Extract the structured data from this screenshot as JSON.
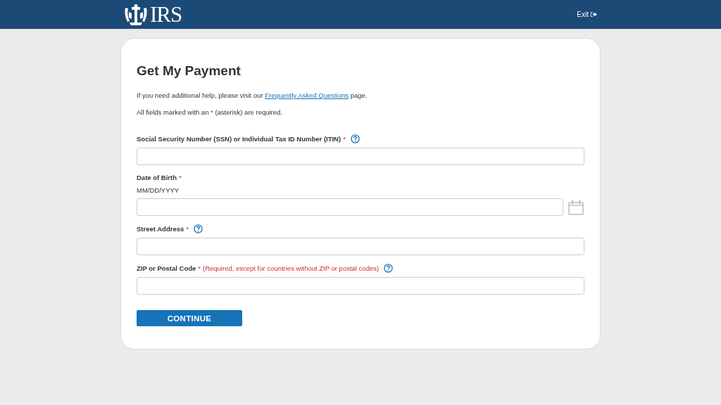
{
  "header": {
    "logo_text": "IRS",
    "exit_link": "Exit"
  },
  "form": {
    "title": "Get My Payment",
    "help_text": {
      "before": "If you need additional help, please visit our",
      "link": "Frequently Asked Questions",
      "after": "page."
    },
    "required_note": {
      "before": "All fields marked with an",
      "mark": "*",
      "after": "(asterisk) are required."
    },
    "fields": [
      {
        "kind": "text",
        "label": "Social Security Number (SSN) or Individual Tax ID Number (ITIN)",
        "required_mark": "*",
        "help": true
      },
      {
        "kind": "date",
        "label": "Date of Birth",
        "required_mark": "*",
        "help": false,
        "hint": "MM/DD/YYYY"
      },
      {
        "kind": "text",
        "label": "Street Address",
        "required_mark": "*",
        "help": true
      },
      {
        "kind": "text",
        "label": "ZIP or Postal Code",
        "required_mark": "*",
        "note": "(Required, except for countries without ZIP or postal codes)",
        "help": true
      }
    ],
    "submit_button": "CONTINUE"
  }
}
